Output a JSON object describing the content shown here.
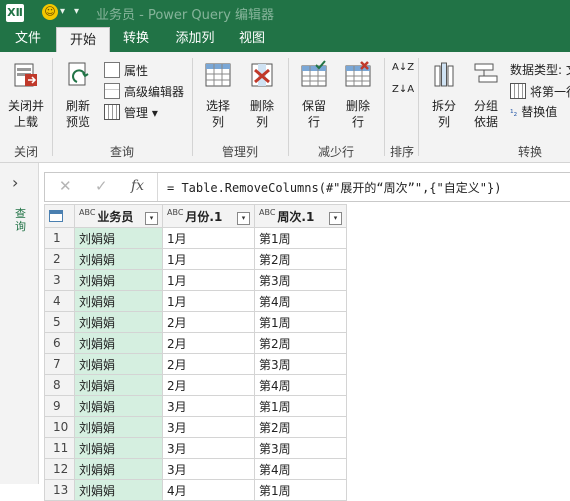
{
  "titlebar": {
    "app_icon": "XⅡ",
    "smiley": "☺",
    "title": "业务员 - Power Query 编辑器"
  },
  "tabs": [
    "文件",
    "开始",
    "转换",
    "添加列",
    "视图"
  ],
  "ribbon": {
    "close_load": "关闭并\n上载",
    "refresh_preview": "刷新\n预览",
    "properties": "属性",
    "advanced_editor": "高级编辑器",
    "manage": "管理",
    "choose_cols": "选择\n列",
    "remove_cols": "删除\n列",
    "keep_rows": "保留\n行",
    "remove_rows": "删除\n行",
    "sort_asc": "A↓Z",
    "sort_desc": "Z↓A",
    "split_col": "拆分\n列",
    "group_by": "分组\n依据",
    "datatype": "数据类型: 文",
    "use_first_row": "将第一行",
    "replace_values": "替换值",
    "groups": {
      "close": "关闭",
      "query": "查询",
      "manage_cols": "管理列",
      "reduce_rows": "减少行",
      "sort": "排序",
      "transform": "转换"
    }
  },
  "leftpane": {
    "label": "查询"
  },
  "formula": {
    "text": "= Table.RemoveColumns(#\"展开的“周次”\",{\"自定义\"})",
    "fx": "fx",
    "cancel": "✕",
    "commit": "✓"
  },
  "table": {
    "columns": [
      {
        "type": "ABC",
        "name": "业务员"
      },
      {
        "type": "ABC",
        "name": "月份.1"
      },
      {
        "type": "ABC",
        "name": "周次.1"
      }
    ],
    "rows": [
      [
        "1",
        "刘娟娟",
        "1月",
        "第1周"
      ],
      [
        "2",
        "刘娟娟",
        "1月",
        "第2周"
      ],
      [
        "3",
        "刘娟娟",
        "1月",
        "第3周"
      ],
      [
        "4",
        "刘娟娟",
        "1月",
        "第4周"
      ],
      [
        "5",
        "刘娟娟",
        "2月",
        "第1周"
      ],
      [
        "6",
        "刘娟娟",
        "2月",
        "第2周"
      ],
      [
        "7",
        "刘娟娟",
        "2月",
        "第3周"
      ],
      [
        "8",
        "刘娟娟",
        "2月",
        "第4周"
      ],
      [
        "9",
        "刘娟娟",
        "3月",
        "第1周"
      ],
      [
        "10",
        "刘娟娟",
        "3月",
        "第2周"
      ],
      [
        "11",
        "刘娟娟",
        "3月",
        "第3周"
      ],
      [
        "12",
        "刘娟娟",
        "3月",
        "第4周"
      ],
      [
        "13",
        "刘娟娟",
        "4月",
        "第1周"
      ]
    ]
  },
  "colors": {
    "excel_green": "#217346",
    "selected_column": "#d5efe0"
  }
}
